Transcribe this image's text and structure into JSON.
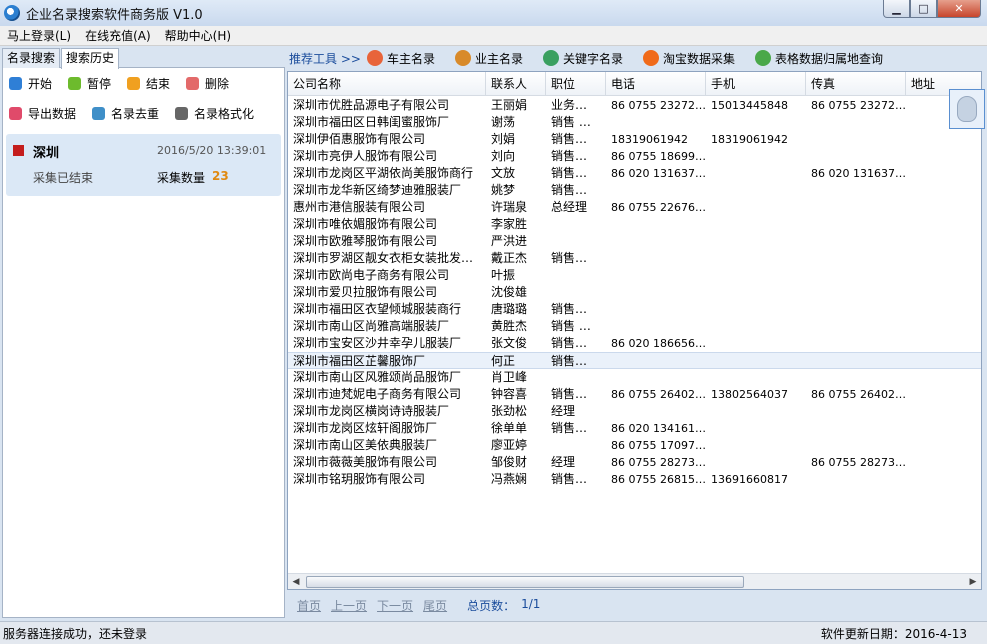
{
  "window": {
    "title": "企业名录搜索软件商务版 V1.0",
    "min_glyph": "▁",
    "max_glyph": "□",
    "close_glyph": "✕"
  },
  "menu": [
    "马上登录(L)",
    "在线充值(A)",
    "帮助中心(H)"
  ],
  "left_tabs": [
    "名录搜索",
    "搜索历史"
  ],
  "left_tools_row1": [
    {
      "label": "开始",
      "icon": "play-icon",
      "color": "#2f7fd6"
    },
    {
      "label": "暂停",
      "icon": "pause-icon",
      "color": "#6dbb2d"
    },
    {
      "label": "结束",
      "icon": "stop-icon",
      "color": "#f0a020"
    },
    {
      "label": "删除",
      "icon": "delete-icon",
      "color": "#e36a6a"
    }
  ],
  "left_tools_row2": [
    {
      "label": "导出数据",
      "icon": "export-icon",
      "color": "#e04a6a"
    },
    {
      "label": "名录去重",
      "icon": "dedupe-icon",
      "color": "#3f8fc8"
    },
    {
      "label": "名录格式化",
      "icon": "format-icon",
      "color": "#666666"
    }
  ],
  "history": {
    "city": "深圳",
    "time": "2016/5/20 13:39:01",
    "status": "采集已结束",
    "count_label": "采集数量",
    "count": "23"
  },
  "right_toolbar": {
    "label": "推荐工具 >>",
    "items": [
      {
        "label": "车主名录",
        "icon": "car-owner-icon",
        "color": "#e8643a"
      },
      {
        "label": "业主名录",
        "icon": "house-owner-icon",
        "color": "#d88a2a"
      },
      {
        "label": "关键字名录",
        "icon": "keyword-icon",
        "color": "#3aa060"
      },
      {
        "label": "淘宝数据采集",
        "icon": "taobao-icon",
        "color": "#f06a1a"
      },
      {
        "label": "表格数据归属地查询",
        "icon": "location-query-icon",
        "color": "#4aa84a"
      }
    ]
  },
  "grid": {
    "columns": [
      "公司名称",
      "联系人",
      "职位",
      "电话",
      "手机",
      "传真",
      "地址"
    ],
    "rows": [
      [
        "深圳市优胜品源电子有限公司",
        "王丽娟",
        "业务…",
        "86 0755 23272…",
        "15013445848",
        "86 0755 23272…",
        ""
      ],
      [
        "深圳市福田区日韩闺蜜服饰厂",
        "谢荡",
        "销售 …",
        "",
        "",
        "",
        ""
      ],
      [
        "深圳伊佰惠服饰有限公司",
        "刘娟",
        "销售…",
        "18319061942",
        "18319061942",
        "",
        ""
      ],
      [
        "深圳市亮伊人服饰有限公司",
        "刘向",
        "销售…",
        "86 0755 18699…",
        "",
        "",
        ""
      ],
      [
        "深圳市龙岗区平湖依尚美服饰商行",
        "文放",
        "销售…",
        "86 020 131637…",
        "",
        "86 020 131637…",
        ""
      ],
      [
        "深圳市龙华新区绮梦迪雅服装厂",
        "姚梦",
        "销售…",
        "",
        "",
        "",
        ""
      ],
      [
        "惠州市港信服装有限公司",
        "许瑞泉",
        "总经理",
        "86 0755 22676…",
        "",
        "",
        ""
      ],
      [
        "深圳市唯依媚服饰有限公司",
        "李家胜",
        "",
        "",
        "",
        "",
        ""
      ],
      [
        "深圳市欧雅琴服饰有限公司",
        "严洪进",
        "",
        "",
        "",
        "",
        ""
      ],
      [
        "深圳市罗湖区靓女衣柜女装批发…",
        "戴正杰",
        "销售…",
        "",
        "",
        "",
        ""
      ],
      [
        "深圳市欧尚电子商务有限公司",
        "叶振",
        "",
        "",
        "",
        "",
        ""
      ],
      [
        "深圳市爱贝拉服饰有限公司",
        "沈俊雄",
        "",
        "",
        "",
        "",
        ""
      ],
      [
        "深圳市福田区衣望倾城服装商行",
        "唐璐璐",
        "销售…",
        "",
        "",
        "",
        ""
      ],
      [
        "深圳市南山区尚雅高端服装厂",
        "黄胜杰",
        "销售 …",
        "",
        "",
        "",
        ""
      ],
      [
        "深圳市宝安区沙井幸孕儿服装厂",
        "张文俊",
        "销售…",
        "86 020 186656…",
        "",
        "",
        ""
      ],
      [
        "深圳市福田区芷馨服饰厂",
        "何正",
        "销售…",
        "",
        "",
        "",
        ""
      ],
      [
        "深圳市南山区风雅颂尚品服饰厂",
        "肖卫峰",
        "",
        "",
        "",
        "",
        ""
      ],
      [
        "深圳市迪梵妮电子商务有限公司",
        "钟容喜",
        "销售…",
        "86 0755 26402…",
        "13802564037",
        "86 0755 26402…",
        ""
      ],
      [
        "深圳市龙岗区横岗诗诗服装厂",
        "张劲松",
        "经理",
        "",
        "",
        "",
        ""
      ],
      [
        "深圳市龙岗区炫轩阁服饰厂",
        "徐单单",
        "销售…",
        "86 020 134161…",
        "",
        "",
        ""
      ],
      [
        "深圳市南山区美依典服装厂",
        "廖亚婷",
        "",
        "86 0755 17097…",
        "",
        "",
        ""
      ],
      [
        "深圳市薇薇美服饰有限公司",
        "邹俊财",
        "经理",
        "86 0755 28273…",
        "",
        "86 0755 28273…",
        ""
      ],
      [
        "深圳市铭玥服饰有限公司",
        "冯燕娴",
        "销售…",
        "86 0755 26815…",
        "13691660817",
        "",
        ""
      ]
    ],
    "selected_row": 15
  },
  "pager": {
    "first": "首页",
    "prev": "上一页",
    "next": "下一页",
    "last": "尾页",
    "total_label": "总页数：",
    "total_value": "1/1"
  },
  "status": {
    "left": "服务器连接成功，还未登录",
    "right": "软件更新日期：2016-4-13"
  },
  "scroll": {
    "left_arrow": "◀",
    "right_arrow": "▶"
  }
}
